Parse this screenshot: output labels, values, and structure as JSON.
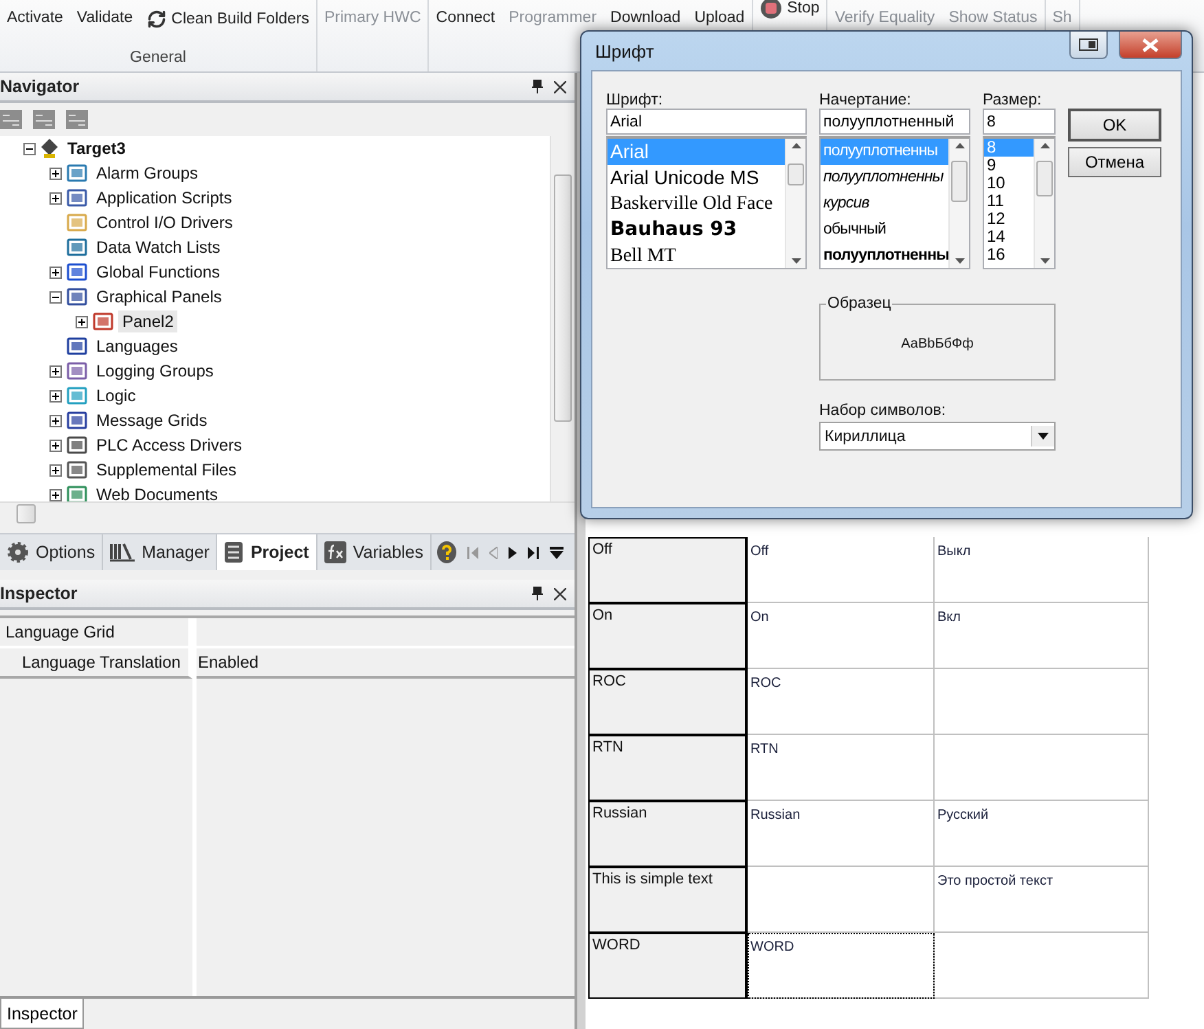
{
  "ribbon": {
    "groups": [
      {
        "label": "General",
        "items": [
          {
            "label": "Activate",
            "disabled": false,
            "kind": "dropdown"
          },
          {
            "label": "Validate",
            "disabled": false,
            "kind": "large"
          },
          {
            "label": "Clean Build Folders",
            "disabled": false,
            "kind": "small"
          }
        ]
      },
      {
        "items": [
          {
            "label": "Primary HWC",
            "disabled": true,
            "kind": "large"
          }
        ]
      },
      {
        "items": [
          {
            "label": "Connect",
            "disabled": false,
            "kind": "large"
          },
          {
            "label": "Programmer",
            "disabled": true,
            "kind": "large"
          },
          {
            "label": "Download",
            "disabled": false,
            "kind": "large"
          },
          {
            "label": "Upload",
            "disabled": false,
            "kind": "large"
          }
        ]
      },
      {
        "items": [
          {
            "label": "Stop",
            "disabled": false,
            "kind": "stop"
          }
        ]
      },
      {
        "items": [
          {
            "label": "Verify Equality",
            "disabled": true,
            "kind": "large"
          },
          {
            "label": "Show Status",
            "disabled": true,
            "kind": "large"
          }
        ]
      },
      {
        "items": [
          {
            "label": "Sh",
            "disabled": true,
            "kind": "small"
          }
        ]
      }
    ]
  },
  "navigator": {
    "title": "Navigator",
    "tree": [
      {
        "label": "Target3",
        "kind": "branch",
        "expanded": true,
        "selected": false,
        "children": [
          {
            "label": "Alarm Groups",
            "kind": "branch",
            "expanded": false,
            "selected": false
          },
          {
            "label": "Application Scripts",
            "kind": "branch",
            "expanded": false,
            "selected": false
          },
          {
            "label": "Control I/O Drivers",
            "kind": "leaf",
            "selected": false
          },
          {
            "label": "Data Watch Lists",
            "kind": "leaf",
            "selected": false
          },
          {
            "label": "Global Functions",
            "kind": "branch",
            "expanded": false,
            "selected": false
          },
          {
            "label": "Graphical Panels",
            "kind": "branch",
            "expanded": true,
            "selected": false,
            "children": [
              {
                "label": "Panel2",
                "kind": "branch",
                "expanded": false,
                "selected": true
              }
            ]
          },
          {
            "label": "Languages",
            "kind": "leaf",
            "selected": false
          },
          {
            "label": "Logging Groups",
            "kind": "branch",
            "expanded": false,
            "selected": false
          },
          {
            "label": "Logic",
            "kind": "branch",
            "expanded": false,
            "selected": false
          },
          {
            "label": "Message Grids",
            "kind": "branch",
            "expanded": false,
            "selected": false
          },
          {
            "label": "PLC Access Drivers",
            "kind": "branch",
            "expanded": false,
            "selected": false
          },
          {
            "label": "Supplemental Files",
            "kind": "branch",
            "expanded": false,
            "selected": false
          },
          {
            "label": "Web Documents",
            "kind": "branch",
            "expanded": false,
            "selected": false
          }
        ]
      }
    ]
  },
  "panel_tabs": [
    {
      "label": "Options",
      "selected": false
    },
    {
      "label": "Manager",
      "selected": false
    },
    {
      "label": "Project",
      "selected": true
    },
    {
      "label": "Variables",
      "selected": false
    }
  ],
  "inspector": {
    "title": "Inspector",
    "rows": [
      {
        "kind": "category",
        "label": "Language Grid"
      },
      {
        "kind": "property",
        "label": "Language Translation",
        "value": "Enabled"
      }
    ],
    "bottom_tab": "Inspector"
  },
  "language_grid": {
    "rows": [
      {
        "name": "Off",
        "text": "Off",
        "translation": "Выкл",
        "focused": false
      },
      {
        "name": "On",
        "text": "On",
        "translation": "Вкл",
        "focused": false
      },
      {
        "name": "ROC",
        "text": "ROC",
        "focused": false
      },
      {
        "name": "RTN",
        "text": "RTN",
        "focused": false
      },
      {
        "name": "Russian",
        "text": "Russian",
        "translation": "Русский",
        "focused": false
      },
      {
        "name": "This is simple text",
        "translation": "Это простой текст",
        "focused": false
      },
      {
        "name": "WORD",
        "text": "WORD",
        "focused": true
      }
    ]
  },
  "font_dialog": {
    "title": "Шрифт",
    "font": {
      "label": "Шрифт:",
      "value": "Arial",
      "items": [
        {
          "label": "Arial",
          "selected": true
        },
        {
          "label": "Arial Unicode MS",
          "selected": false
        },
        {
          "label": "Baskerville Old Face",
          "selected": false
        },
        {
          "label": "Bauhaus 93",
          "selected": false
        },
        {
          "label": "Bell MT",
          "selected": false
        }
      ]
    },
    "style": {
      "label": "Начертание:",
      "value": "полууплотненный",
      "items": [
        {
          "label": "полууплотненны",
          "selected": true
        },
        {
          "label": "полууплотненны",
          "selected": false
        },
        {
          "label": "курсив",
          "selected": false
        },
        {
          "label": "обычный",
          "selected": false
        },
        {
          "label": "полууплотненны",
          "selected": false
        }
      ]
    },
    "size": {
      "label": "Размер:",
      "value": "8",
      "items": [
        {
          "label": "8",
          "selected": true
        },
        {
          "label": "9",
          "selected": false
        },
        {
          "label": "10",
          "selected": false
        },
        {
          "label": "11",
          "selected": false
        },
        {
          "label": "12",
          "selected": false
        },
        {
          "label": "14",
          "selected": false
        },
        {
          "label": "16",
          "selected": false
        }
      ]
    },
    "buttons": [
      "OK",
      "Отмена"
    ],
    "sample": {
      "label": "Образец",
      "text": "АаBbБбФф"
    },
    "charset": {
      "label": "Набор символов:",
      "value": "Кириллица"
    }
  }
}
